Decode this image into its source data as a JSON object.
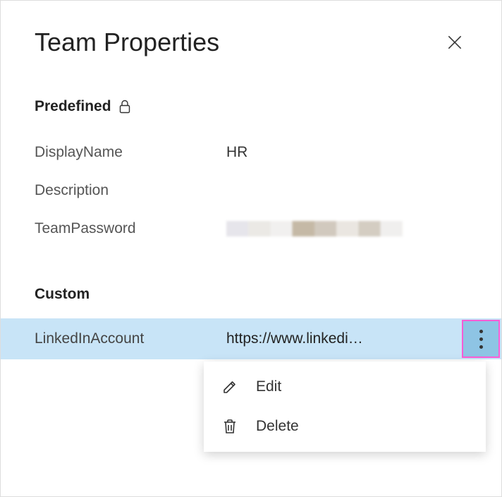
{
  "header": {
    "title": "Team Properties"
  },
  "sections": {
    "predefined": {
      "title": "Predefined",
      "rows": {
        "displayName": {
          "label": "DisplayName",
          "value": "HR"
        },
        "description": {
          "label": "Description",
          "value": ""
        },
        "teamPassword": {
          "label": "TeamPassword"
        }
      }
    },
    "custom": {
      "title": "Custom",
      "rows": {
        "linkedin": {
          "label": "LinkedInAccount",
          "value": "https://www.linkedi…"
        }
      }
    }
  },
  "menu": {
    "edit": "Edit",
    "delete": "Delete"
  }
}
